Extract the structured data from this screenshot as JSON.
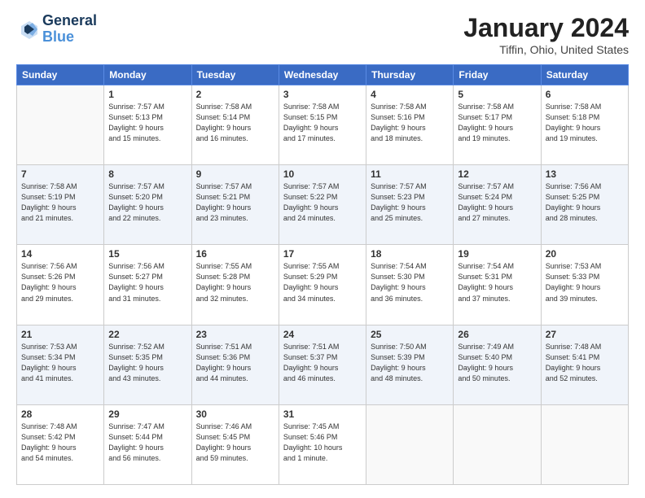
{
  "header": {
    "logo_line1": "General",
    "logo_line2": "Blue",
    "month": "January 2024",
    "location": "Tiffin, Ohio, United States"
  },
  "days_of_week": [
    "Sunday",
    "Monday",
    "Tuesday",
    "Wednesday",
    "Thursday",
    "Friday",
    "Saturday"
  ],
  "weeks": [
    [
      {
        "day": "",
        "content": ""
      },
      {
        "day": "1",
        "content": "Sunrise: 7:57 AM\nSunset: 5:13 PM\nDaylight: 9 hours\nand 15 minutes."
      },
      {
        "day": "2",
        "content": "Sunrise: 7:58 AM\nSunset: 5:14 PM\nDaylight: 9 hours\nand 16 minutes."
      },
      {
        "day": "3",
        "content": "Sunrise: 7:58 AM\nSunset: 5:15 PM\nDaylight: 9 hours\nand 17 minutes."
      },
      {
        "day": "4",
        "content": "Sunrise: 7:58 AM\nSunset: 5:16 PM\nDaylight: 9 hours\nand 18 minutes."
      },
      {
        "day": "5",
        "content": "Sunrise: 7:58 AM\nSunset: 5:17 PM\nDaylight: 9 hours\nand 19 minutes."
      },
      {
        "day": "6",
        "content": "Sunrise: 7:58 AM\nSunset: 5:18 PM\nDaylight: 9 hours\nand 19 minutes."
      }
    ],
    [
      {
        "day": "7",
        "content": "Sunrise: 7:58 AM\nSunset: 5:19 PM\nDaylight: 9 hours\nand 21 minutes."
      },
      {
        "day": "8",
        "content": "Sunrise: 7:57 AM\nSunset: 5:20 PM\nDaylight: 9 hours\nand 22 minutes."
      },
      {
        "day": "9",
        "content": "Sunrise: 7:57 AM\nSunset: 5:21 PM\nDaylight: 9 hours\nand 23 minutes."
      },
      {
        "day": "10",
        "content": "Sunrise: 7:57 AM\nSunset: 5:22 PM\nDaylight: 9 hours\nand 24 minutes."
      },
      {
        "day": "11",
        "content": "Sunrise: 7:57 AM\nSunset: 5:23 PM\nDaylight: 9 hours\nand 25 minutes."
      },
      {
        "day": "12",
        "content": "Sunrise: 7:57 AM\nSunset: 5:24 PM\nDaylight: 9 hours\nand 27 minutes."
      },
      {
        "day": "13",
        "content": "Sunrise: 7:56 AM\nSunset: 5:25 PM\nDaylight: 9 hours\nand 28 minutes."
      }
    ],
    [
      {
        "day": "14",
        "content": "Sunrise: 7:56 AM\nSunset: 5:26 PM\nDaylight: 9 hours\nand 29 minutes."
      },
      {
        "day": "15",
        "content": "Sunrise: 7:56 AM\nSunset: 5:27 PM\nDaylight: 9 hours\nand 31 minutes."
      },
      {
        "day": "16",
        "content": "Sunrise: 7:55 AM\nSunset: 5:28 PM\nDaylight: 9 hours\nand 32 minutes."
      },
      {
        "day": "17",
        "content": "Sunrise: 7:55 AM\nSunset: 5:29 PM\nDaylight: 9 hours\nand 34 minutes."
      },
      {
        "day": "18",
        "content": "Sunrise: 7:54 AM\nSunset: 5:30 PM\nDaylight: 9 hours\nand 36 minutes."
      },
      {
        "day": "19",
        "content": "Sunrise: 7:54 AM\nSunset: 5:31 PM\nDaylight: 9 hours\nand 37 minutes."
      },
      {
        "day": "20",
        "content": "Sunrise: 7:53 AM\nSunset: 5:33 PM\nDaylight: 9 hours\nand 39 minutes."
      }
    ],
    [
      {
        "day": "21",
        "content": "Sunrise: 7:53 AM\nSunset: 5:34 PM\nDaylight: 9 hours\nand 41 minutes."
      },
      {
        "day": "22",
        "content": "Sunrise: 7:52 AM\nSunset: 5:35 PM\nDaylight: 9 hours\nand 43 minutes."
      },
      {
        "day": "23",
        "content": "Sunrise: 7:51 AM\nSunset: 5:36 PM\nDaylight: 9 hours\nand 44 minutes."
      },
      {
        "day": "24",
        "content": "Sunrise: 7:51 AM\nSunset: 5:37 PM\nDaylight: 9 hours\nand 46 minutes."
      },
      {
        "day": "25",
        "content": "Sunrise: 7:50 AM\nSunset: 5:39 PM\nDaylight: 9 hours\nand 48 minutes."
      },
      {
        "day": "26",
        "content": "Sunrise: 7:49 AM\nSunset: 5:40 PM\nDaylight: 9 hours\nand 50 minutes."
      },
      {
        "day": "27",
        "content": "Sunrise: 7:48 AM\nSunset: 5:41 PM\nDaylight: 9 hours\nand 52 minutes."
      }
    ],
    [
      {
        "day": "28",
        "content": "Sunrise: 7:48 AM\nSunset: 5:42 PM\nDaylight: 9 hours\nand 54 minutes."
      },
      {
        "day": "29",
        "content": "Sunrise: 7:47 AM\nSunset: 5:44 PM\nDaylight: 9 hours\nand 56 minutes."
      },
      {
        "day": "30",
        "content": "Sunrise: 7:46 AM\nSunset: 5:45 PM\nDaylight: 9 hours\nand 59 minutes."
      },
      {
        "day": "31",
        "content": "Sunrise: 7:45 AM\nSunset: 5:46 PM\nDaylight: 10 hours\nand 1 minute."
      },
      {
        "day": "",
        "content": ""
      },
      {
        "day": "",
        "content": ""
      },
      {
        "day": "",
        "content": ""
      }
    ]
  ]
}
